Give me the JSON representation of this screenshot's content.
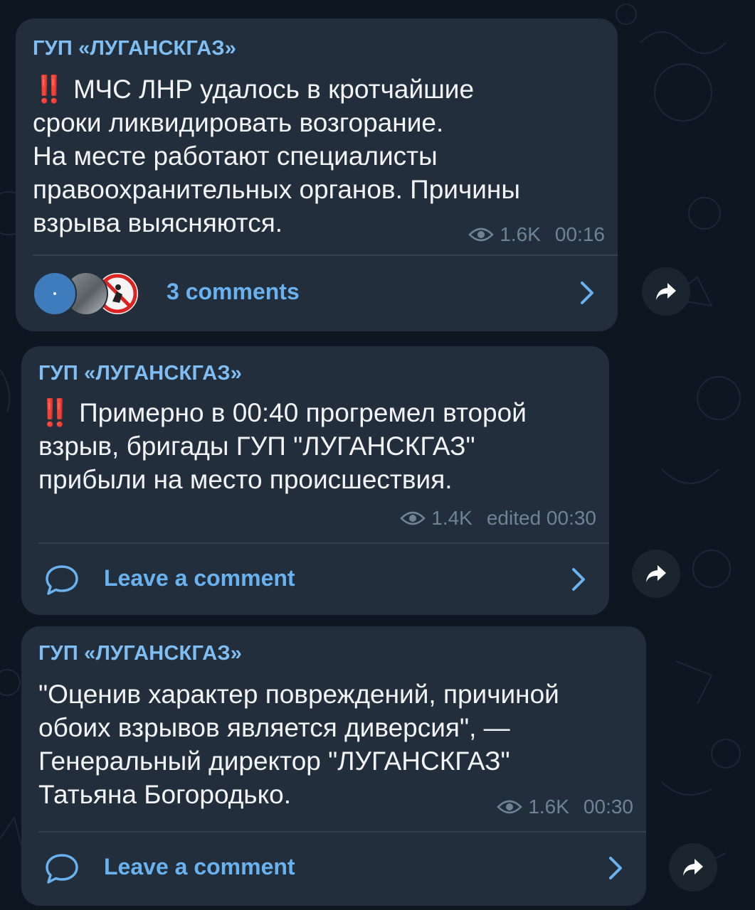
{
  "messages": [
    {
      "author": "ГУП «ЛУГАНСКГАЗ»",
      "exclamation": "‼️",
      "text": "МЧС ЛНР удалось в кротчайшие\nсроки ликвидировать возгорание.\nНа месте работают специалисты\nправоохранительных органов. Причины\nвзрыва выясняются.",
      "views": "1.6K",
      "time": "00:16",
      "comments_label": "3 comments"
    },
    {
      "author": "ГУП «ЛУГАНСКГАЗ»",
      "exclamation": "‼️",
      "text": "Примерно в 00:40 прогремел второй\nвзрыв, бригады ГУП \"ЛУГАНСКГАЗ\"\nприбыли на место происшествия.",
      "views": "1.4K",
      "time": "edited 00:30",
      "comments_label": "Leave a comment"
    },
    {
      "author": "ГУП «ЛУГАНСКГАЗ»",
      "text": "\"Оценив характер повреждений, причиной\nобоих взрывов является диверсия\", —\nГенеральный директор \"ЛУГАНСКГАЗ\"\nТатьяна Богородько.",
      "views": "1.6K",
      "time": "00:30",
      "comments_label": "Leave a comment"
    }
  ],
  "icons": {
    "views": "eye-icon",
    "comment": "comment-bubble-icon",
    "chevron": "chevron-right-icon",
    "share": "share-arrow-icon"
  },
  "colors": {
    "background": "#0e1621",
    "bubble": "#222e3b",
    "author": "#7fbdf3",
    "link": "#6ab2ef",
    "meta": "#6f8396",
    "exclamation": "#e0313a"
  }
}
